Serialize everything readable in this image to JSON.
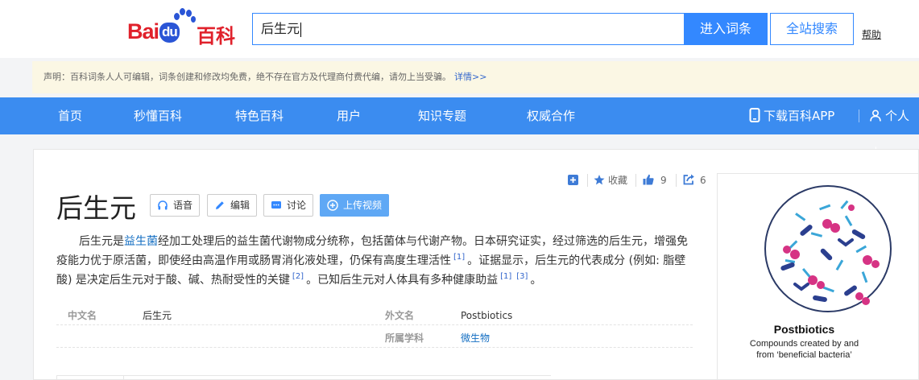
{
  "header": {
    "logo_text_left": "Bai",
    "logo_text_du": "du",
    "logo_text_right": "百科",
    "search_value": "后生元",
    "enter_label": "进入词条",
    "search_all_label": "全站搜索",
    "help_label": "帮助"
  },
  "notice": {
    "text": "声明：百科词条人人可编辑，词条创建和修改均免费，绝不存在官方及代理商付费代编，请勿上当受骗。",
    "more": "详情>>"
  },
  "nav": {
    "items": [
      "首页",
      "秒懂百科",
      "特色百科",
      "用户",
      "知识专题",
      "权威合作"
    ],
    "download": "下载百科APP",
    "personal": "个人中"
  },
  "entry": {
    "title": "后生元",
    "buttons": {
      "voice": "语音",
      "edit": "编辑",
      "discuss": "讨论",
      "upload": "上传视频"
    },
    "tools": {
      "collect": "收藏",
      "like_count": "9",
      "share_count": "6"
    },
    "summary": {
      "p1": "后生元是",
      "link": "益生菌",
      "p2": "经加工处理后的益生菌代谢物成分统称，包括菌体与代谢产物。日本研究证实，经过筛选的后生元，增强免疫能力优于原活菌，即使经由高温作用或肠胃消化液处理，仍保有高度生理活性",
      "ref1": "[1]",
      "p3": "。证据显示，后生元的代表成分 (例如: 脂壁酸) 是决定后生元对于酸、碱、热耐受性的关键",
      "ref2": "[2]",
      "p4": "。已知后生元对人体具有多种健康助益",
      "ref3": "[1]",
      "ref4": "[3]",
      "p5": "。"
    },
    "basic_info": {
      "name_cn_label": "中文名",
      "name_cn_value": "后生元",
      "name_foreign_label": "外文名",
      "name_foreign_value": "Postbiotics",
      "subject_label": "所属学科",
      "subject_value": "微生物"
    }
  },
  "album": {
    "title": "Postbiotics",
    "subtitle_line1": "Compounds created by and",
    "subtitle_line2": "from ‘beneficial bacteria’"
  },
  "colors": {
    "brand_red": "#e0212b",
    "brand_blue": "#3388ff",
    "nav_blue": "#3b8cf0",
    "link_blue": "#136ec2"
  }
}
